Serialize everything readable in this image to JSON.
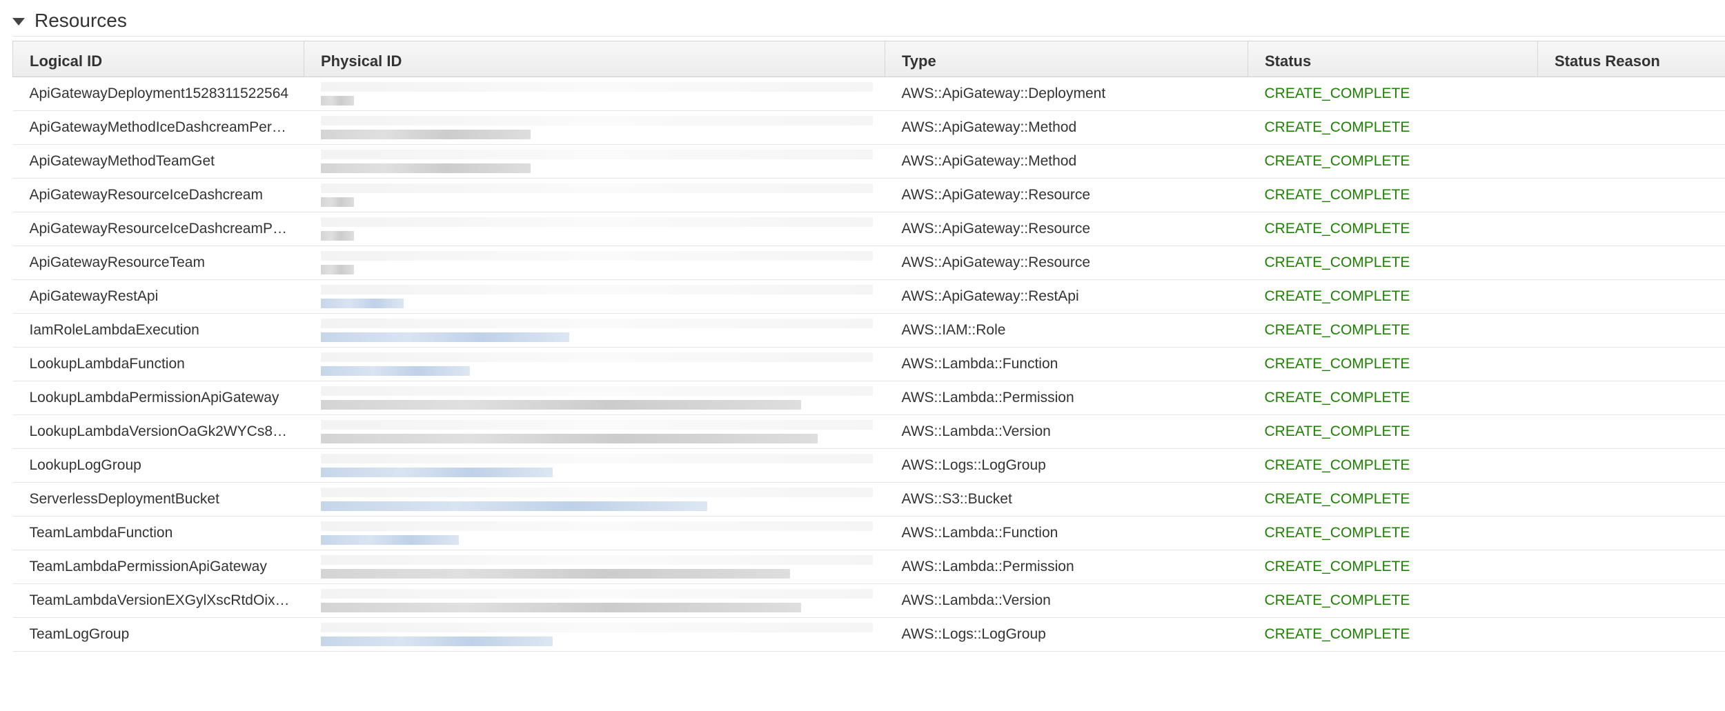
{
  "section": {
    "title": "Resources",
    "toggle_icon": "caret-down-icon"
  },
  "table": {
    "columns": [
      "Logical ID",
      "Physical ID",
      "Type",
      "Status",
      "Status Reason"
    ],
    "rows": [
      {
        "logical_id": "ApiGatewayDeployment1528311522564",
        "type": "AWS::ApiGateway::Deployment",
        "status": "CREATE_COMPLETE",
        "reason": "",
        "physical_tone": "grey",
        "physical_fill": 0.06
      },
      {
        "logical_id": "ApiGatewayMethodIceDashcreamPer…",
        "type": "AWS::ApiGateway::Method",
        "status": "CREATE_COMPLETE",
        "reason": "",
        "physical_tone": "grey",
        "physical_fill": 0.38
      },
      {
        "logical_id": "ApiGatewayMethodTeamGet",
        "type": "AWS::ApiGateway::Method",
        "status": "CREATE_COMPLETE",
        "reason": "",
        "physical_tone": "grey",
        "physical_fill": 0.38
      },
      {
        "logical_id": "ApiGatewayResourceIceDashcream",
        "type": "AWS::ApiGateway::Resource",
        "status": "CREATE_COMPLETE",
        "reason": "",
        "physical_tone": "grey",
        "physical_fill": 0.06
      },
      {
        "logical_id": "ApiGatewayResourceIceDashcreamP…",
        "type": "AWS::ApiGateway::Resource",
        "status": "CREATE_COMPLETE",
        "reason": "",
        "physical_tone": "grey",
        "physical_fill": 0.06
      },
      {
        "logical_id": "ApiGatewayResourceTeam",
        "type": "AWS::ApiGateway::Resource",
        "status": "CREATE_COMPLETE",
        "reason": "",
        "physical_tone": "grey",
        "physical_fill": 0.06
      },
      {
        "logical_id": "ApiGatewayRestApi",
        "type": "AWS::ApiGateway::RestApi",
        "status": "CREATE_COMPLETE",
        "reason": "",
        "physical_tone": "blue",
        "physical_fill": 0.15
      },
      {
        "logical_id": "IamRoleLambdaExecution",
        "type": "AWS::IAM::Role",
        "status": "CREATE_COMPLETE",
        "reason": "",
        "physical_tone": "blue",
        "physical_fill": 0.45
      },
      {
        "logical_id": "LookupLambdaFunction",
        "type": "AWS::Lambda::Function",
        "status": "CREATE_COMPLETE",
        "reason": "",
        "physical_tone": "blue",
        "physical_fill": 0.27
      },
      {
        "logical_id": "LookupLambdaPermissionApiGateway",
        "type": "AWS::Lambda::Permission",
        "status": "CREATE_COMPLETE",
        "reason": "",
        "physical_tone": "grey",
        "physical_fill": 0.87
      },
      {
        "logical_id": "LookupLambdaVersionOaGk2WYCs8…",
        "type": "AWS::Lambda::Version",
        "status": "CREATE_COMPLETE",
        "reason": "",
        "physical_tone": "grey",
        "physical_fill": 0.9
      },
      {
        "logical_id": "LookupLogGroup",
        "type": "AWS::Logs::LogGroup",
        "status": "CREATE_COMPLETE",
        "reason": "",
        "physical_tone": "blue",
        "physical_fill": 0.42
      },
      {
        "logical_id": "ServerlessDeploymentBucket",
        "type": "AWS::S3::Bucket",
        "status": "CREATE_COMPLETE",
        "reason": "",
        "physical_tone": "blue",
        "physical_fill": 0.7
      },
      {
        "logical_id": "TeamLambdaFunction",
        "type": "AWS::Lambda::Function",
        "status": "CREATE_COMPLETE",
        "reason": "",
        "physical_tone": "blue",
        "physical_fill": 0.25
      },
      {
        "logical_id": "TeamLambdaPermissionApiGateway",
        "type": "AWS::Lambda::Permission",
        "status": "CREATE_COMPLETE",
        "reason": "",
        "physical_tone": "grey",
        "physical_fill": 0.85
      },
      {
        "logical_id": "TeamLambdaVersionEXGylXscRtdOix…",
        "type": "AWS::Lambda::Version",
        "status": "CREATE_COMPLETE",
        "reason": "",
        "physical_tone": "grey",
        "physical_fill": 0.87
      },
      {
        "logical_id": "TeamLogGroup",
        "type": "AWS::Logs::LogGroup",
        "status": "CREATE_COMPLETE",
        "reason": "",
        "physical_tone": "blue",
        "physical_fill": 0.42
      }
    ]
  }
}
